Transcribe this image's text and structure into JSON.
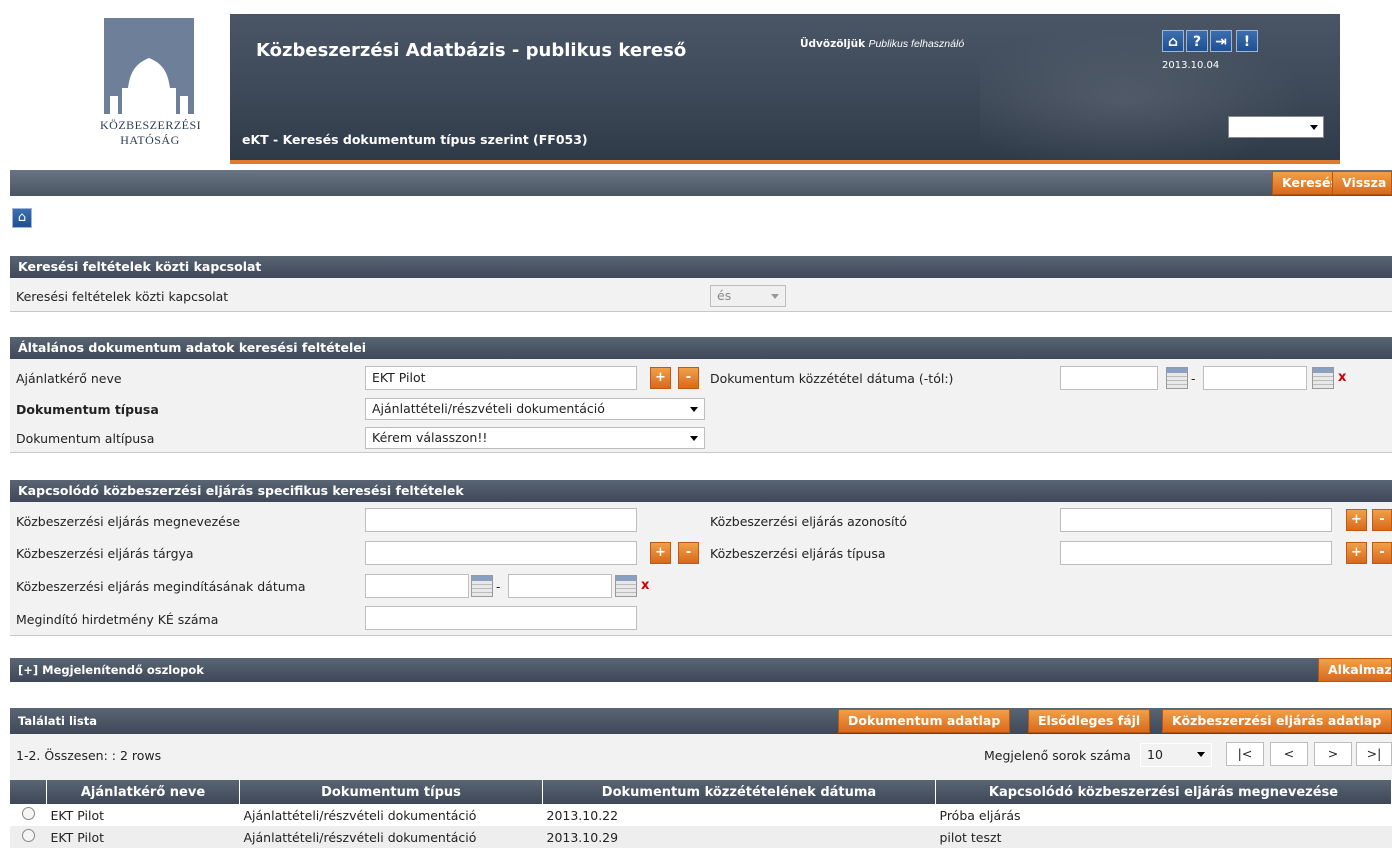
{
  "header": {
    "logo_line1": "KÖZBESZERZÉSI",
    "logo_line2": "HATÓSÁG",
    "title": "Közbeszerzési Adatbázis - publikus kereső",
    "subtitle": "eKT - Keresés dokumentum típus szerint (FF053)",
    "welcome_label": "Üdvözöljük",
    "welcome_user": "Publikus felhasználó",
    "date": "2013.10.04",
    "icons": [
      "home-icon",
      "help-icon",
      "logout-icon",
      "alert-icon"
    ],
    "icon_glyphs": {
      "home": "⌂",
      "help": "?",
      "logout": "⇥",
      "alert": "!"
    },
    "language_select_value": ""
  },
  "toolbar": {
    "search_label": "Keresés",
    "back_label": "Vissza"
  },
  "section_relation": {
    "title": "Keresési feltételek közti kapcsolat",
    "label": "Keresési feltételek közti kapcsolat",
    "value": "és"
  },
  "section_general": {
    "title": "Általános dokumentum adatok keresési feltételei",
    "contracting_label": "Ajánlatkérő neve",
    "contracting_value": "EKT Pilot",
    "pub_date_label": "Dokumentum közzététel dátuma (-tól:)",
    "pub_date_from": "",
    "pub_date_to": "",
    "doc_type_label": "Dokumentum típusa",
    "doc_type_value": "Ajánlattételi/részvételi dokumentáció",
    "doc_subtype_label": "Dokumentum altípusa",
    "doc_subtype_value": "Kérem válasszon!!"
  },
  "section_procedure": {
    "title": "Kapcsolódó közbeszerzési eljárás specifikus keresési feltételek",
    "name_label": "Közbeszerzési eljárás megnevezése",
    "id_label": "Közbeszerzési eljárás azonosító",
    "subject_label": "Közbeszerzési eljárás tárgya",
    "type_label": "Közbeszerzési eljárás típusa",
    "start_date_label": "Közbeszerzési eljárás megindításának dátuma",
    "notice_label": "Megindító hirdetmény KÉ száma",
    "name_value": "",
    "id_value": "",
    "subject_value": "",
    "type_value": "",
    "notice_value": ""
  },
  "columns_panel": {
    "title": "[+] Megjelenítendő oszlopok",
    "apply_label": "Alkalmaz"
  },
  "results": {
    "title": "Találati lista",
    "btn_doc": "Dokumentum adatlap",
    "btn_file": "Elsődleges fájl",
    "btn_proc": "Közbeszerzési eljárás adatlap",
    "summary": "1-2. Összesen: : 2 rows",
    "rows_label": "Megjelenő sorok száma",
    "rows_value": "10",
    "pager": [
      "|<",
      "<",
      ">",
      ">|"
    ],
    "columns": [
      "Ajánlatkérő neve",
      "Dokumentum típus",
      "Dokumentum közzétételének dátuma",
      "Kapcsolódó közbeszerzési eljárás megnevezése"
    ],
    "rows": [
      [
        "EKT Pilot",
        "Ajánlattételi/részvételi dokumentáció",
        "2013.10.22",
        "Próba eljárás"
      ],
      [
        "EKT Pilot",
        "Ajánlattételi/részvételi dokumentáció",
        "2013.10.29",
        "pilot teszt"
      ]
    ]
  },
  "colors": {
    "accent_orange": "#d9691c",
    "header_dark": "#3c4756",
    "icon_blue": "#1d4f91"
  }
}
